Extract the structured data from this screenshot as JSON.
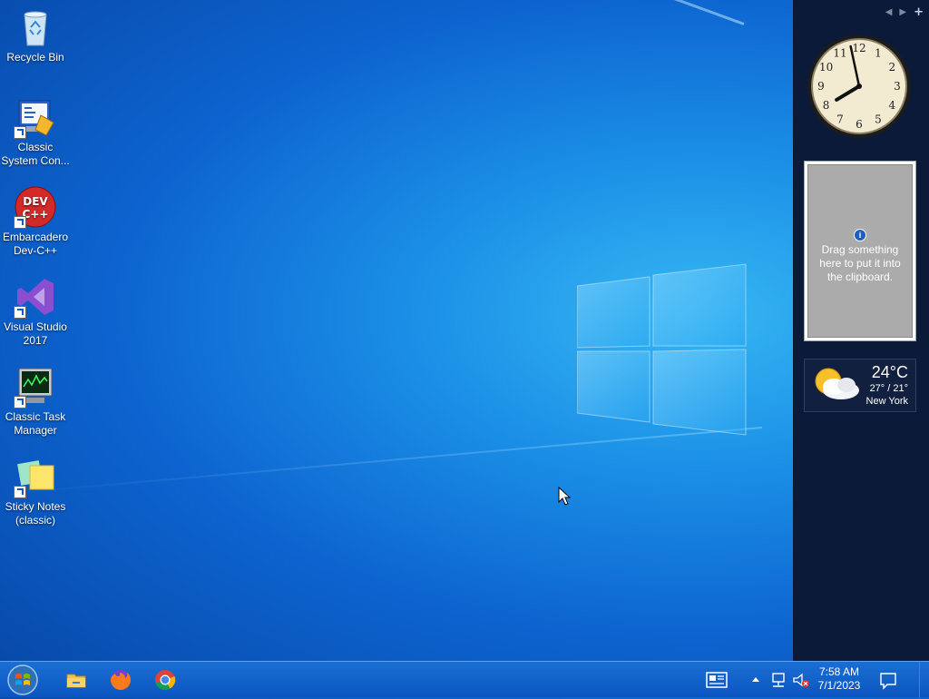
{
  "desktop": {
    "icons": [
      {
        "label": "Recycle Bin",
        "icon": "recycle-bin-icon"
      },
      {
        "label": "Classic System Con...",
        "icon": "control-panel-icon"
      },
      {
        "label": "Embarcadero Dev-C++",
        "icon": "devcpp-icon"
      },
      {
        "label": "Visual Studio 2017",
        "icon": "visual-studio-icon"
      },
      {
        "label": "Classic Task Manager",
        "icon": "task-manager-icon"
      },
      {
        "label": "Sticky Notes (classic)",
        "icon": "sticky-notes-icon"
      }
    ]
  },
  "sidebar": {
    "nav_prev": "◀",
    "nav_next": "▶",
    "add": "+",
    "clock": {
      "hour": 7,
      "minute": 58
    },
    "clipboard": {
      "message": "Drag something here to put it into the clipboard."
    },
    "weather": {
      "temp": "24°C",
      "range": "27° / 21°",
      "city": "New York"
    }
  },
  "taskbar": {
    "pinned": [
      "file-explorer-icon",
      "firefox-icon",
      "chrome-icon"
    ],
    "tray_icons": [
      "news-icon",
      "show-hidden-icons-icon",
      "network-icon",
      "volume-muted-icon"
    ],
    "time": "7:58 AM",
    "date": "7/1/2023"
  },
  "colors": {
    "accent": "#0b55c0",
    "sidebar": "#0c1a3a"
  }
}
